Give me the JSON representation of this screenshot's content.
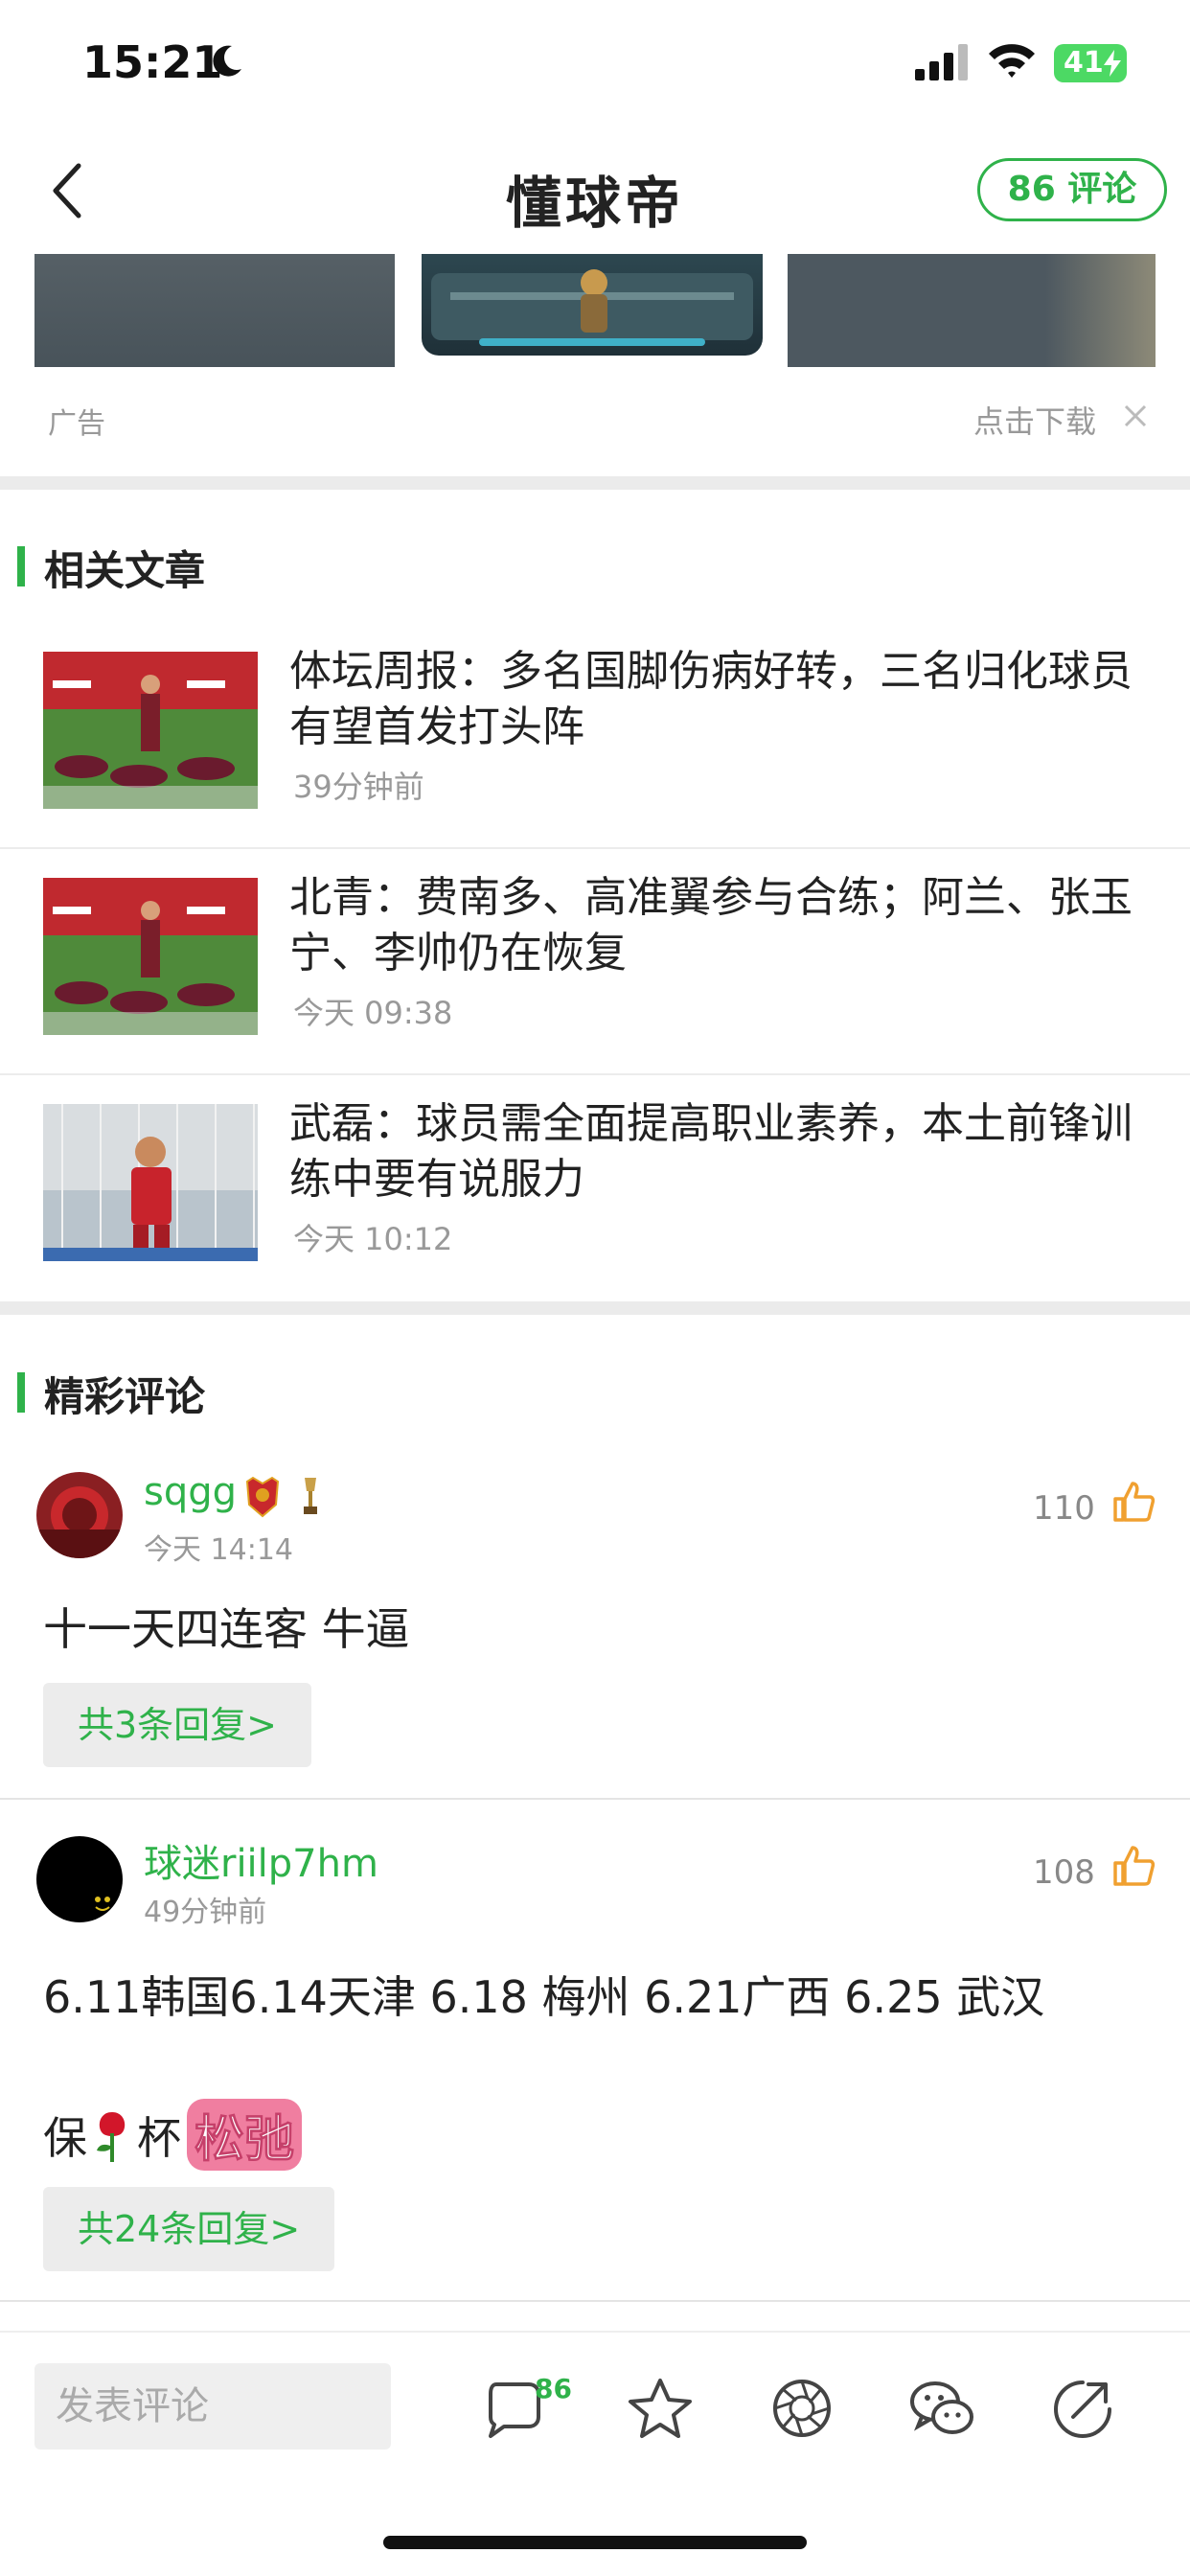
{
  "status_bar": {
    "time": "15:21",
    "battery": "41"
  },
  "nav": {
    "title": "懂球帝",
    "comment_count_label": "86 评论"
  },
  "ad": {
    "label": "广告",
    "download": "点击下载"
  },
  "related": {
    "heading": "相关文章",
    "articles": [
      {
        "title": "体坛周报：多名国脚伤病好转，三名归化球员有望首发打头阵",
        "time": "39分钟前"
      },
      {
        "title": "北青：费南多、高准翼参与合练；阿兰、张玉宁、李帅仍在恢复",
        "time": "今天 09:38"
      },
      {
        "title": "武磊：球员需全面提高职业素养，本土前锋训练中要有说服力",
        "time": "今天 10:12"
      }
    ]
  },
  "comments_section": {
    "heading": "精彩评论",
    "comments": [
      {
        "user": "sqgg",
        "time": "今天 14:14",
        "likes": "110",
        "text": "十一天四连客 牛逼",
        "replies": "共3条回复>"
      },
      {
        "user": "球迷riilp7hm",
        "time": "49分钟前",
        "likes": "108",
        "text": "6.11韩国6.14天津 6.18 梅州 6.21广西 6.25 武汉",
        "text2_prefix": "保",
        "text2_mid": "杯",
        "text2_sticker": "松弛",
        "replies": "共24条回复>"
      }
    ]
  },
  "bottom_bar": {
    "input_placeholder": "发表评论",
    "comment_badge": "86"
  },
  "colors": {
    "accent": "#2fb24a",
    "like": "#f0a030"
  },
  "icons": [
    "back-arrow-icon",
    "moon-icon",
    "signal-icon",
    "wifi-icon",
    "battery-icon",
    "close-icon",
    "thumb-up-icon",
    "comment-icon",
    "star-icon",
    "moments-icon",
    "wechat-icon",
    "share-icon"
  ]
}
